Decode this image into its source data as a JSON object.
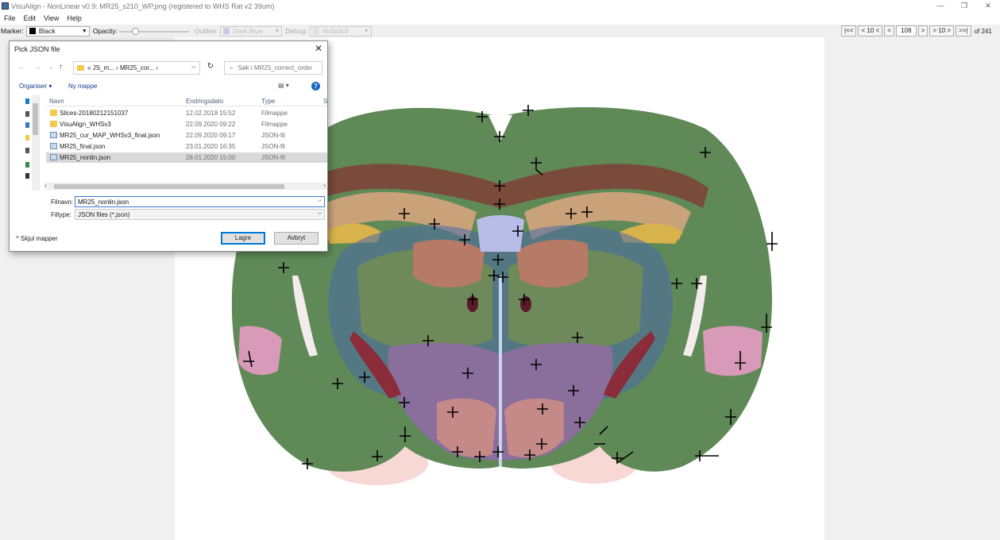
{
  "window": {
    "title": "VisuAlign - NonLinear v0.9: MR25_s210_WP.png (registered to WHS Rat v2 39um)",
    "minimize": "—",
    "restore": "❐",
    "close": "✕"
  },
  "menu": [
    "File",
    "Edit",
    "View",
    "Help"
  ],
  "toolbar": {
    "marker_label": "Marker:",
    "marker_value": "Black",
    "marker_color": "#000000",
    "opacity_label": "Opacity:",
    "opacity_level": 0.2,
    "outline_label": "Outline:",
    "outline_value": "Dark Blue",
    "outline_color": "#c6cbe8",
    "debug_label": "Debug:",
    "debug_value": "#b3b3b3"
  },
  "pager": {
    "first": "|<<",
    "back10": "< 10 <",
    "back1": "<",
    "current": "108",
    "fwd1": ">",
    "fwd10": "> 10 >",
    "last": ">>|",
    "of_label": "of 241"
  },
  "dialog": {
    "title": "Pick JSON file",
    "close": "✕",
    "nav": {
      "back": "←",
      "forward": "→",
      "recent": "⌄",
      "up": "↑"
    },
    "address": [
      "«",
      "JS_m...",
      "›",
      "MR25_cor...",
      "›"
    ],
    "address_dropdown": "⌵",
    "refresh": "↻",
    "search_placeholder": "Søk i MR25_correct_order",
    "organise": "Organiser ▾",
    "new_folder": "Ny mappe",
    "view": "▤ ▾",
    "help": "?",
    "columns": {
      "name": "Navn",
      "date": "Endringsdato",
      "type": "Type",
      "size": "S"
    },
    "files": [
      {
        "name": "Slices-20180212151037",
        "date": "12.02.2018 15:52",
        "type": "Filmappe",
        "kind": "folder"
      },
      {
        "name": "VisuAlign_WHSv3",
        "date": "22.09.2020 09:22",
        "type": "Filmappe",
        "kind": "folder"
      },
      {
        "name": "MR25_cur_MAP_WHSv3_final.json",
        "date": "22.09.2020 09:17",
        "type": "JSON-fil",
        "kind": "json"
      },
      {
        "name": "MR25_final.json",
        "date": "23.01.2020 16:35",
        "type": "JSON-fil",
        "kind": "json"
      },
      {
        "name": "MR25_nonlin.json",
        "date": "28.01.2020 15:00",
        "type": "JSON-fil",
        "kind": "json",
        "selected": true
      }
    ],
    "filename_label": "Filnavn:",
    "filename_value": "MR25_nonlin.json",
    "filetype_label": "Filtype:",
    "filetype_value": "JSON files (*.json)",
    "hide_folders": "Skjul mapper",
    "save_button": "Lagre",
    "cancel_button": "Avbryt"
  }
}
